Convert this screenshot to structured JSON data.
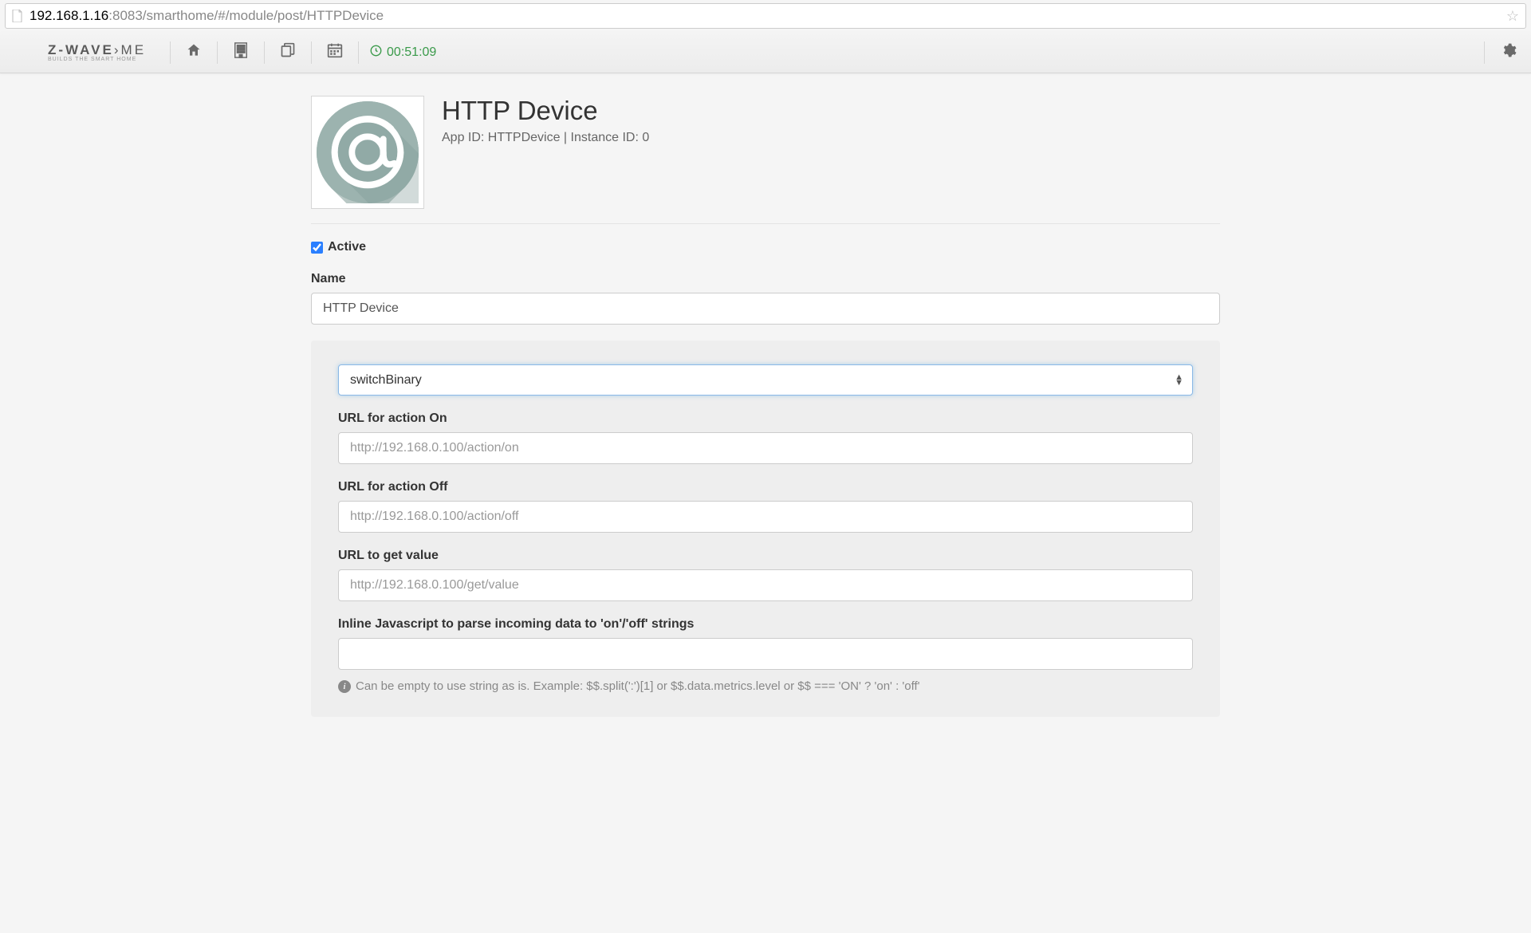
{
  "browser": {
    "url_ip": "192.168.1.16",
    "url_rest": ":8083/smarthome/#/module/post/HTTPDevice"
  },
  "topbar": {
    "logo_main_1": "Z-WAVE",
    "logo_main_2": "ME",
    "logo_sub": "BUILDS THE SMART HOME",
    "clock": "00:51:09"
  },
  "module": {
    "title": "HTTP Device",
    "meta": "App ID: HTTPDevice | Instance ID: 0"
  },
  "form": {
    "active_label": "Active",
    "active_checked": true,
    "name_label": "Name",
    "name_value": "HTTP Device",
    "device_type": "switchBinary",
    "url_on_label": "URL for action On",
    "url_on_placeholder": "http://192.168.0.100/action/on",
    "url_off_label": "URL for action Off",
    "url_off_placeholder": "http://192.168.0.100/action/off",
    "url_get_label": "URL to get value",
    "url_get_placeholder": "http://192.168.0.100/get/value",
    "inline_js_label": "Inline Javascript to parse incoming data to 'on'/'off' strings",
    "inline_js_help": "Can be empty to use string as is. Example: $$.split(':')[1] or $$.data.metrics.level or $$ === 'ON' ? 'on' : 'off'"
  }
}
